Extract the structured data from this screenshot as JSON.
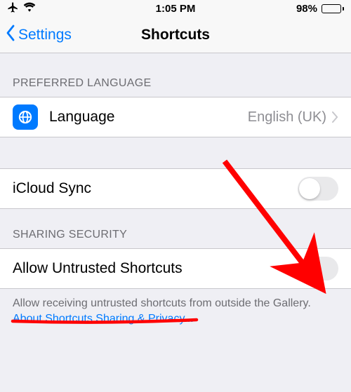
{
  "status": {
    "time": "1:05 PM",
    "battery_pct": "98%"
  },
  "nav": {
    "back_label": "Settings",
    "title": "Shortcuts"
  },
  "sections": {
    "language_header": "PREFERRED LANGUAGE",
    "language_label": "Language",
    "language_value": "English (UK)",
    "icloud_label": "iCloud Sync",
    "sharing_header": "SHARING SECURITY",
    "untrusted_label": "Allow Untrusted Shortcuts"
  },
  "footer": {
    "text": "Allow receiving untrusted shortcuts from outside the Gallery. ",
    "link": "About Shortcuts Sharing & Privacy..."
  },
  "colors": {
    "accent": "#007aff",
    "annotation": "#ff0000",
    "battery_fill": "#ffcc00"
  },
  "toggles": {
    "icloud_sync": false,
    "allow_untrusted": false
  }
}
